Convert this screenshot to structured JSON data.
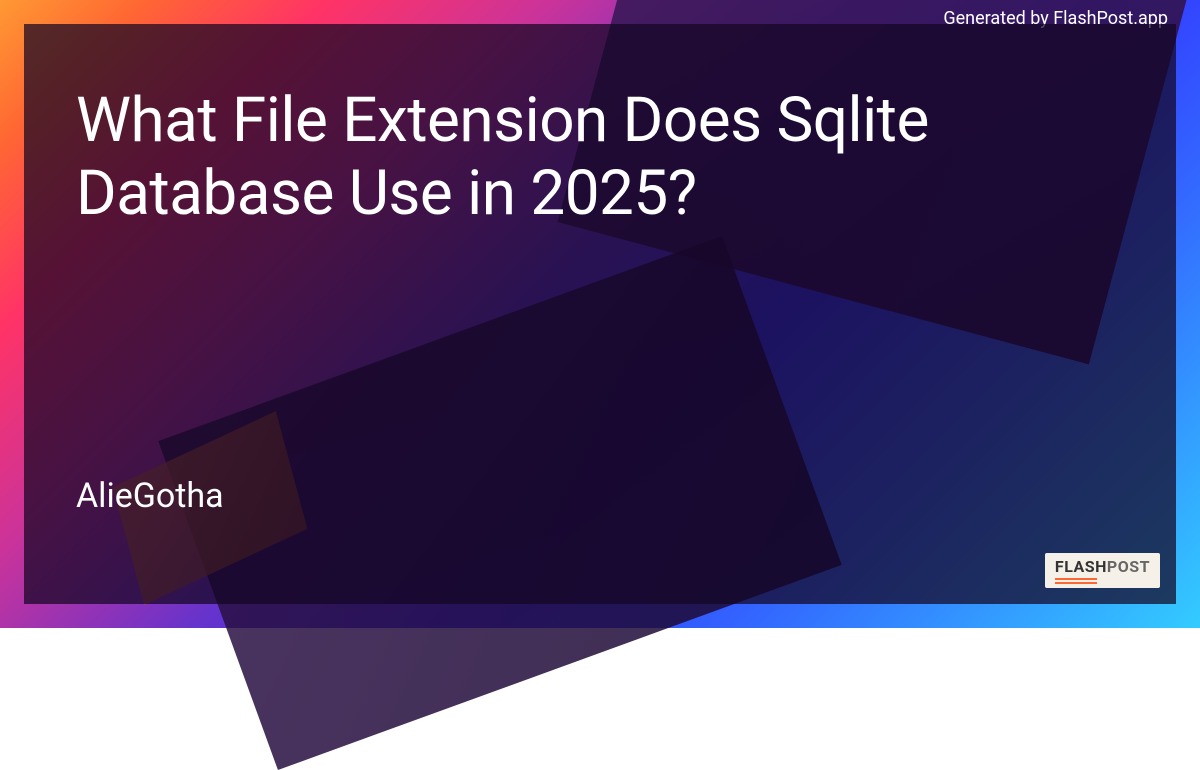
{
  "attribution": "Generated by FlashPost.app",
  "title": "What File Extension Does Sqlite Database Use in 2025?",
  "author": "AlieGotha",
  "logo": {
    "part1": "FLASH",
    "part2": "POST"
  }
}
